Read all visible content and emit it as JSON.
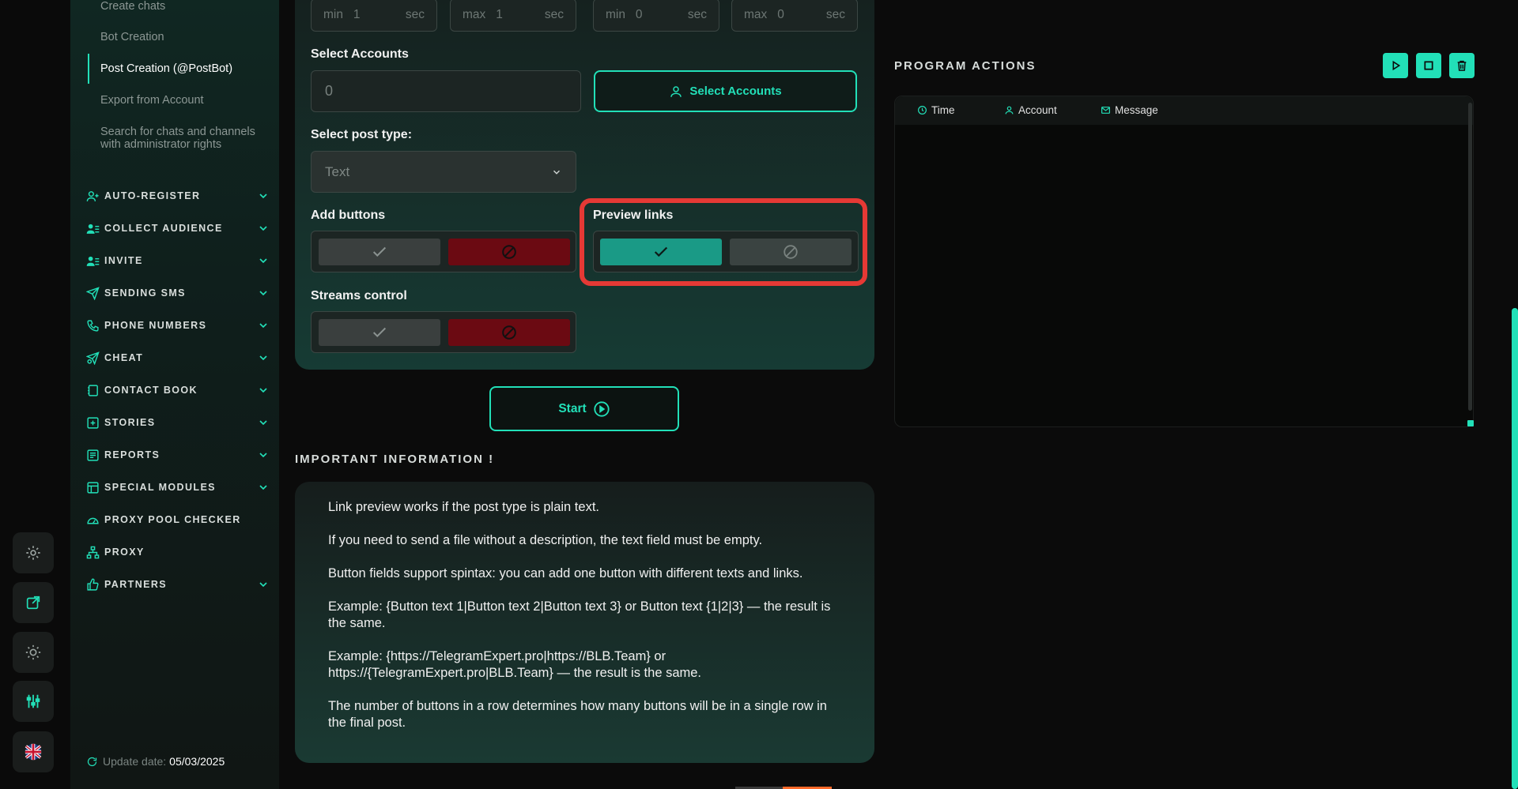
{
  "sidebar": {
    "sub_items": [
      "Create chats",
      "Bot Creation",
      "Post Creation (@PostBot)",
      "Export from Account",
      "Search for chats and channels with administrator rights"
    ],
    "active_sub_index": 2,
    "nav": [
      {
        "label": "AUTO-REGISTER",
        "icon": "user-plus-icon",
        "has_chevron": true
      },
      {
        "label": "COLLECT AUDIENCE",
        "icon": "user-list-icon",
        "has_chevron": true
      },
      {
        "label": "INVITE",
        "icon": "user-list-icon",
        "has_chevron": true
      },
      {
        "label": "SENDING SMS",
        "icon": "send-icon",
        "has_chevron": true
      },
      {
        "label": "PHONE NUMBERS",
        "icon": "phone-icon",
        "has_chevron": true
      },
      {
        "label": "CHEAT",
        "icon": "cheat-icon",
        "has_chevron": true
      },
      {
        "label": "CONTACT BOOK",
        "icon": "book-icon",
        "has_chevron": true
      },
      {
        "label": "STORIES",
        "icon": "plus-square-icon",
        "has_chevron": true
      },
      {
        "label": "REPORTS",
        "icon": "report-icon",
        "has_chevron": true
      },
      {
        "label": "SPECIAL MODULES",
        "icon": "modules-icon",
        "has_chevron": true
      },
      {
        "label": "PROXY POOL CHECKER",
        "icon": "gauge-icon",
        "has_chevron": false
      },
      {
        "label": "PROXY",
        "icon": "network-icon",
        "has_chevron": false
      },
      {
        "label": "PARTNERS",
        "icon": "thumb-icon",
        "has_chevron": true
      }
    ],
    "update_label": "Update date:",
    "update_value": "05/03/2025"
  },
  "form": {
    "delay_inputs": [
      {
        "prefix": "min",
        "value": "1",
        "unit": "sec"
      },
      {
        "prefix": "max",
        "value": "1",
        "unit": "sec"
      },
      {
        "prefix": "min",
        "value": "0",
        "unit": "sec"
      },
      {
        "prefix": "max",
        "value": "0",
        "unit": "sec"
      }
    ],
    "select_accounts_label": "Select Accounts",
    "accounts_count": "0",
    "select_accounts_button": "Select Accounts",
    "post_type_label": "Select post type:",
    "post_type_value": "Text",
    "add_buttons_label": "Add buttons",
    "preview_links_label": "Preview links",
    "streams_control_label": "Streams control",
    "start_button": "Start"
  },
  "info": {
    "title": "IMPORTANT INFORMATION !",
    "lines": [
      "Link preview works if the post type is plain text.",
      "If you need to send a file without a description, the text field must be empty.",
      "Button fields support spintax: you can add one button with different texts and links.",
      "Example: {Button text 1|Button text 2|Button text 3} or Button text {1|2|3} — the result is the same.",
      "Example: {https://TelegramExpert.pro|https://BLB.Team} or https://{TelegramExpert.pro|BLB.Team} — the result is the same.",
      "The number of buttons in a row determines how many buttons will be in a single row in the final post."
    ]
  },
  "actions": {
    "title": "PROGRAM ACTIONS",
    "columns": [
      "Time",
      "Account",
      "Message"
    ]
  },
  "colors": {
    "accent": "#22e0b8",
    "danger": "#6b0a12",
    "highlight": "#e53935"
  }
}
